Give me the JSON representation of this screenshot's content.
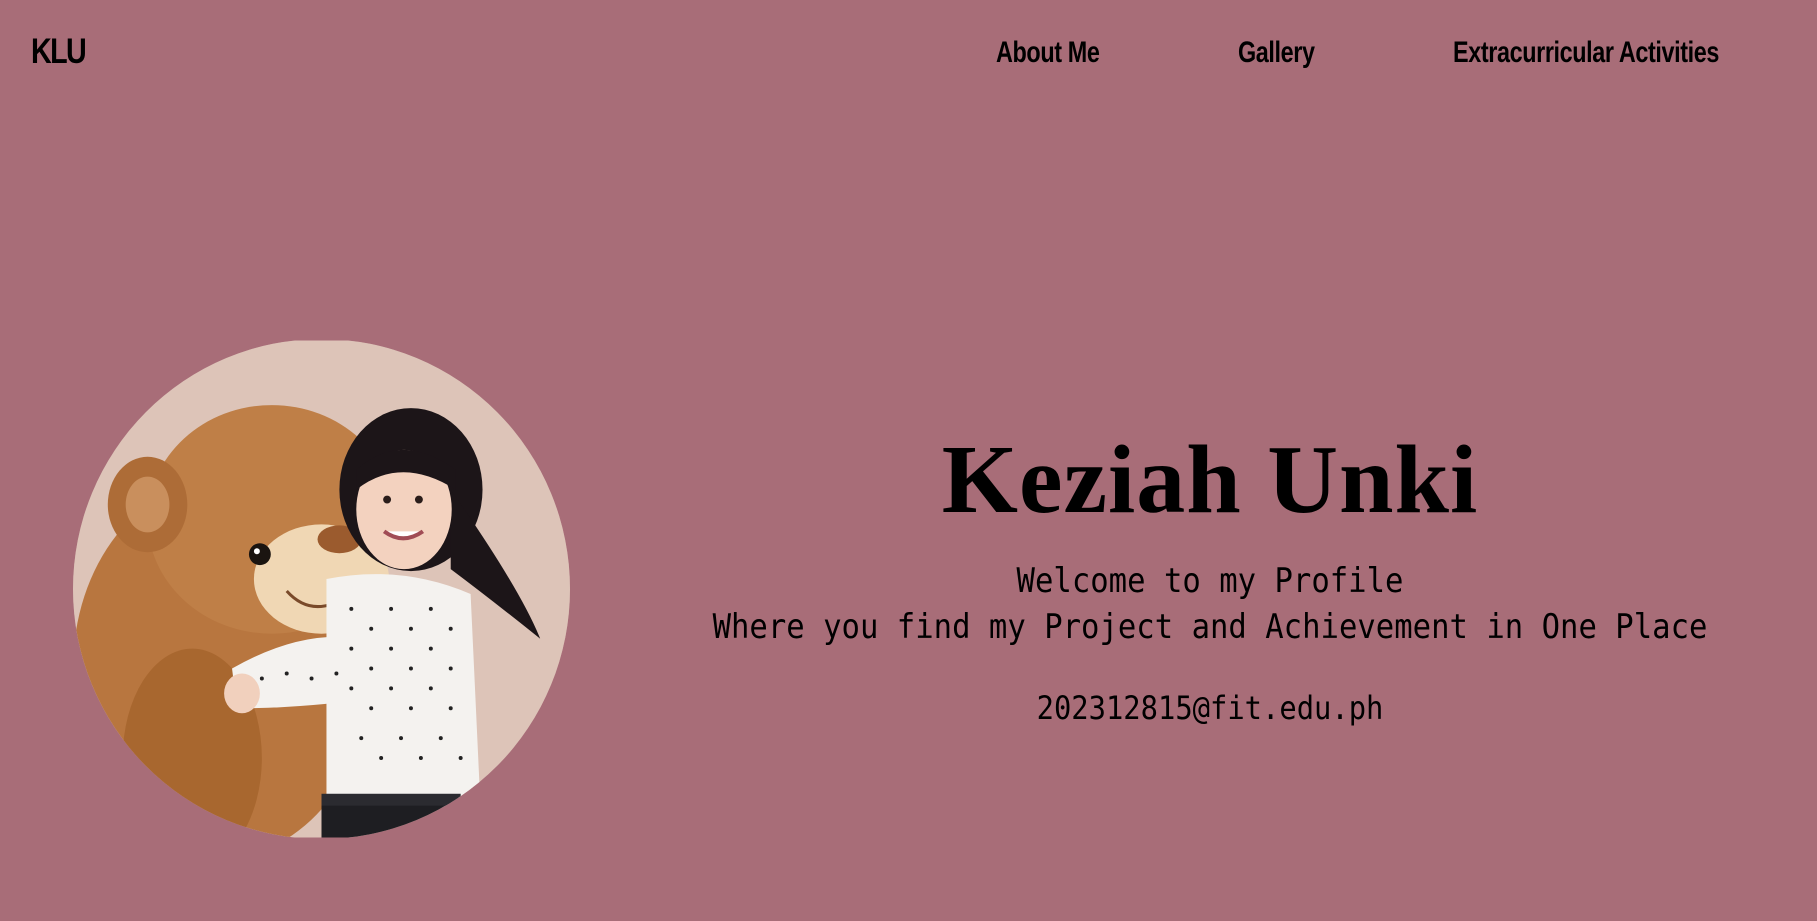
{
  "navbar": {
    "logo": "KLU",
    "links": [
      {
        "label": "About Me"
      },
      {
        "label": "Gallery"
      },
      {
        "label": "Extracurricular Activities"
      }
    ]
  },
  "hero": {
    "name": "Keziah Unki",
    "welcome": "Welcome to my Profile",
    "tagline": "Where you find my Project and Achievement in One Place",
    "email": "202312815@fit.edu.ph"
  },
  "colors": {
    "background": "#a86d78",
    "text": "#000000"
  }
}
